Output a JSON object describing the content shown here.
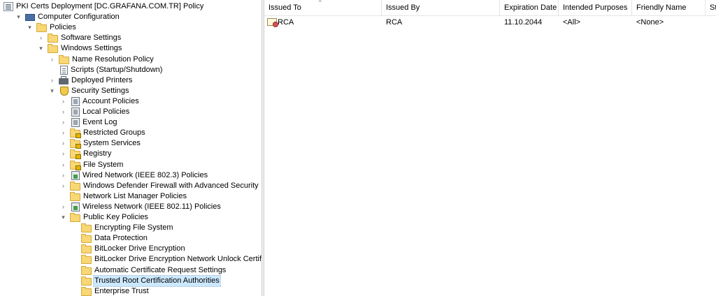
{
  "tree": {
    "items": [
      {
        "label": "PKI Certs Deployment [DC.GRAFANA.COM.TR] Policy",
        "expander": "",
        "icon": "policy-document-icon"
      },
      {
        "label": "Computer Configuration",
        "expander": "▾",
        "icon": "computer-icon"
      },
      {
        "label": "Policies",
        "expander": "▾",
        "icon": "folder-icon"
      },
      {
        "label": "Software Settings",
        "expander": "›",
        "icon": "folder-icon"
      },
      {
        "label": "Windows Settings",
        "expander": "▾",
        "icon": "folder-icon"
      },
      {
        "label": "Name Resolution Policy",
        "expander": "›",
        "icon": "folder-icon"
      },
      {
        "label": "Scripts (Startup/Shutdown)",
        "expander": "",
        "icon": "script-icon"
      },
      {
        "label": "Deployed Printers",
        "expander": "›",
        "icon": "printer-icon"
      },
      {
        "label": "Security Settings",
        "expander": "▾",
        "icon": "security-settings-icon"
      },
      {
        "label": "Account Policies",
        "expander": "›",
        "icon": "policy-book-icon"
      },
      {
        "label": "Local Policies",
        "expander": "›",
        "icon": "policy-book-icon"
      },
      {
        "label": "Event Log",
        "expander": "›",
        "icon": "policy-book-icon"
      },
      {
        "label": "Restricted Groups",
        "expander": "›",
        "icon": "locked-folder-icon"
      },
      {
        "label": "System Services",
        "expander": "›",
        "icon": "locked-folder-icon"
      },
      {
        "label": "Registry",
        "expander": "›",
        "icon": "locked-folder-icon"
      },
      {
        "label": "File System",
        "expander": "›",
        "icon": "locked-folder-icon"
      },
      {
        "label": "Wired Network (IEEE 802.3) Policies",
        "expander": "›",
        "icon": "network-policy-icon"
      },
      {
        "label": "Windows Defender Firewall with Advanced Security",
        "expander": "›",
        "icon": "folder-icon"
      },
      {
        "label": "Network List Manager Policies",
        "expander": "",
        "icon": "folder-icon"
      },
      {
        "label": "Wireless Network (IEEE 802.11) Policies",
        "expander": "›",
        "icon": "network-policy-icon"
      },
      {
        "label": "Public Key Policies",
        "expander": "▾",
        "icon": "folder-icon"
      },
      {
        "label": "Encrypting File System",
        "expander": "",
        "icon": "folder-icon"
      },
      {
        "label": "Data Protection",
        "expander": "",
        "icon": "folder-icon"
      },
      {
        "label": "BitLocker Drive Encryption",
        "expander": "",
        "icon": "folder-icon"
      },
      {
        "label": "BitLocker Drive Encryption Network Unlock Certificate",
        "expander": "",
        "icon": "folder-icon"
      },
      {
        "label": "Automatic Certificate Request Settings",
        "expander": "",
        "icon": "folder-icon"
      },
      {
        "label": "Trusted Root Certification Authorities",
        "expander": "",
        "icon": "folder-icon"
      },
      {
        "label": "Enterprise Trust",
        "expander": "",
        "icon": "folder-icon"
      }
    ]
  },
  "list": {
    "columns": [
      "Issued To",
      "Issued By",
      "Expiration Date",
      "Intended Purposes",
      "Friendly Name",
      "St"
    ],
    "rows": [
      {
        "issued_to": "RCA",
        "issued_by": "RCA",
        "expiration": "11.10.2044",
        "purposes": "<All>",
        "friendly": "<None>",
        "icon": "certificate-icon"
      }
    ]
  },
  "colors": {
    "selection": "#cce8ff",
    "folder": "#f8d775"
  }
}
